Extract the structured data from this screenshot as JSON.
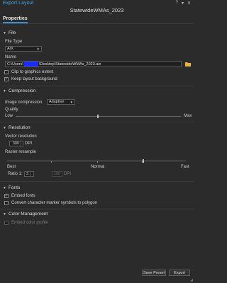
{
  "window": {
    "title": "Export Layout",
    "document_title": "StatewideWMAs_2023",
    "controls": [
      "?",
      "▾",
      "✕"
    ]
  },
  "tabs": [
    "Properties"
  ],
  "file": {
    "header": "File",
    "file_type_label": "File Type",
    "file_type_value": "AIX",
    "name_label": "Name",
    "name_prefix": "C:\\Users\\",
    "name_suffix": "\\Desktop\\StatewideWMAs_2023.aix",
    "clip_label": "Clip to graphics extent",
    "clip_checked": false,
    "keep_bg_label": "Keep layout background",
    "keep_bg_checked": true
  },
  "compression": {
    "header": "Compression",
    "image_compression_label": "Image compression",
    "image_compression_value": "Adaptive",
    "quality_label": "Quality",
    "quality_low": "Low",
    "quality_max": "Max",
    "quality_level": 0.5
  },
  "resolution": {
    "header": "Resolution",
    "vector_label": "Vector resolution",
    "vector_value": "300",
    "vector_unit": "DPI",
    "raster_label": "Raster resample",
    "raster_best": "Best",
    "raster_normal": "Normal",
    "raster_fast": "Fast",
    "ratio_label": "Ratio 1:",
    "ratio_value": "3",
    "ratio_dpi_value": "100",
    "ratio_dpi_unit": "DPI"
  },
  "fonts": {
    "header": "Fonts",
    "embed_label": "Embed fonts",
    "embed_checked": true,
    "convert_label": "Convert character marker symbols to polygon",
    "convert_checked": false
  },
  "color_management": {
    "header": "Color Management",
    "embed_profile_label": "Embed color profile",
    "embed_profile_checked": false
  },
  "footer": {
    "save_preset": "Save Preset",
    "export": "Export"
  }
}
